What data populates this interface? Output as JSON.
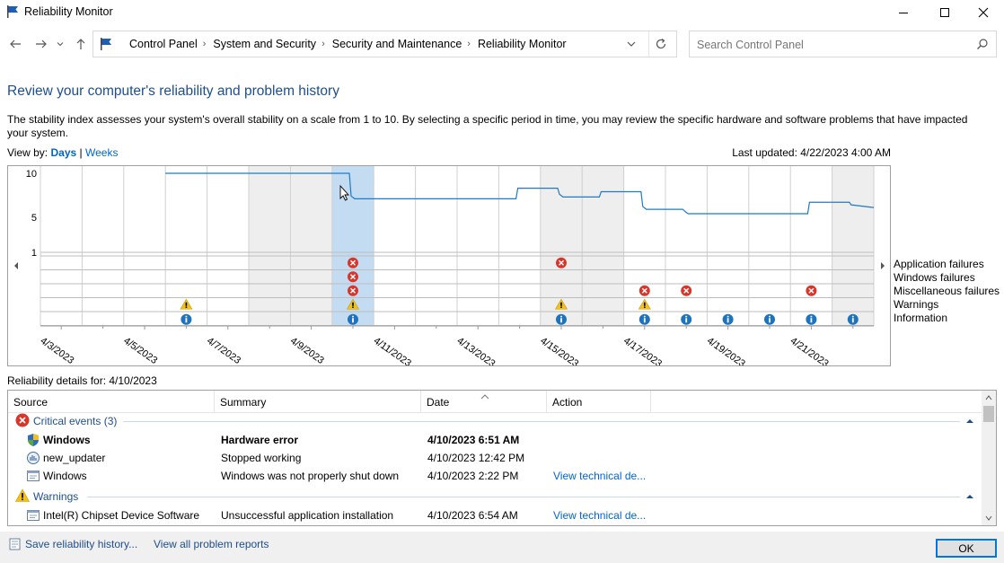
{
  "window": {
    "title": "Reliability Monitor",
    "app_icon": "flag-icon"
  },
  "address": {
    "crumbs": [
      "Control Panel",
      "System and Security",
      "Security and Maintenance",
      "Reliability Monitor"
    ]
  },
  "search": {
    "placeholder": "Search Control Panel"
  },
  "page": {
    "heading": "Review your computer's reliability and problem history",
    "intro": "The stability index assesses your system's overall stability on a scale from 1 to 10. By selecting a specific period in time, you may review the specific hardware and software problems that have impacted your system.",
    "view_by_label": "View by:",
    "view_days": "Days",
    "view_sep": "|",
    "view_weeks": "Weeks",
    "last_updated": "Last updated: 4/22/2023 4:00 AM"
  },
  "chart_data": {
    "type": "line",
    "title": "",
    "ylabel": "",
    "y_ticks": [
      "10",
      "5",
      "1"
    ],
    "ylim": [
      1,
      10
    ],
    "dates": [
      "4/3/2023",
      "4/4/2023",
      "4/5/2023",
      "4/6/2023",
      "4/7/2023",
      "4/8/2023",
      "4/9/2023",
      "4/10/2023",
      "4/11/2023",
      "4/12/2023",
      "4/13/2023",
      "4/14/2023",
      "4/15/2023",
      "4/16/2023",
      "4/17/2023",
      "4/18/2023",
      "4/19/2023",
      "4/20/2023",
      "4/21/2023",
      "4/22/2023"
    ],
    "x_tick_labels": [
      "4/3/2023",
      "4/5/2023",
      "4/7/2023",
      "4/9/2023",
      "4/11/2023",
      "4/13/2023",
      "4/15/2023",
      "4/17/2023",
      "4/19/2023",
      "4/21/2023"
    ],
    "selected_date": "4/10/2023",
    "stability_index": [
      {
        "date": "4/6/2023",
        "value": 10
      },
      {
        "date": "4/9/2023",
        "value": 10
      },
      {
        "date": "4/10/2023",
        "value": 7.1
      },
      {
        "date": "4/14/2023",
        "value": 8.3
      },
      {
        "date": "4/15/2023",
        "value": 7.3
      },
      {
        "date": "4/16/2023",
        "value": 7.9
      },
      {
        "date": "4/17/2023",
        "value": 5.9
      },
      {
        "date": "4/18/2023",
        "value": 5.4
      },
      {
        "date": "4/21/2023",
        "value": 6.7
      },
      {
        "date": "4/22/2023",
        "value": 6.1
      }
    ],
    "event_rows": [
      "Application failures",
      "Windows failures",
      "Miscellaneous failures",
      "Warnings",
      "Information"
    ],
    "events": {
      "Application failures": [
        "4/10/2023",
        "4/15/2023"
      ],
      "Windows failures": [
        "4/10/2023"
      ],
      "Miscellaneous failures": [
        "4/10/2023",
        "4/17/2023",
        "4/18/2023",
        "4/21/2023"
      ],
      "Warnings": [
        "4/6/2023",
        "4/10/2023",
        "4/15/2023",
        "4/17/2023"
      ],
      "Information": [
        "4/6/2023",
        "4/10/2023",
        "4/15/2023",
        "4/17/2023",
        "4/18/2023",
        "4/19/2023",
        "4/20/2023",
        "4/21/2023",
        "4/22/2023"
      ]
    },
    "colors": {
      "line": "#1f7bc4",
      "selected": "#c3dcf2",
      "weekend": "#eeeeee",
      "error": "#d9362b",
      "warning": "#f2c01e",
      "info": "#1e73be"
    }
  },
  "details": {
    "label": "Reliability details for: 4/10/2023",
    "columns": [
      "Source",
      "Summary",
      "Date",
      "Action"
    ],
    "groups": [
      {
        "title": "Critical events (3)",
        "icon": "error-icon",
        "rows": [
          {
            "source": "Windows",
            "summary": "Hardware error",
            "date": "4/10/2023 6:51 AM",
            "action": "",
            "icon": "windows-shield-icon",
            "bold": true
          },
          {
            "source": "new_updater",
            "summary": "Stopped working",
            "date": "4/10/2023 12:42 PM",
            "action": "",
            "icon": "app-icon",
            "bold": false
          },
          {
            "source": "Windows",
            "summary": "Windows was not properly shut down",
            "date": "4/10/2023 2:22 PM",
            "action": "View technical de...",
            "icon": "window-app-icon",
            "bold": false
          }
        ]
      },
      {
        "title": "Warnings",
        "icon": "warning-icon",
        "rows": [
          {
            "source": "Intel(R) Chipset Device Software",
            "summary": "Unsuccessful application installation",
            "date": "4/10/2023 6:54 AM",
            "action": "View technical de...",
            "icon": "window-app-icon",
            "bold": false
          }
        ]
      }
    ]
  },
  "footer": {
    "save_link": "Save reliability history...",
    "view_all_link": "View all problem reports",
    "ok_button": "OK"
  }
}
